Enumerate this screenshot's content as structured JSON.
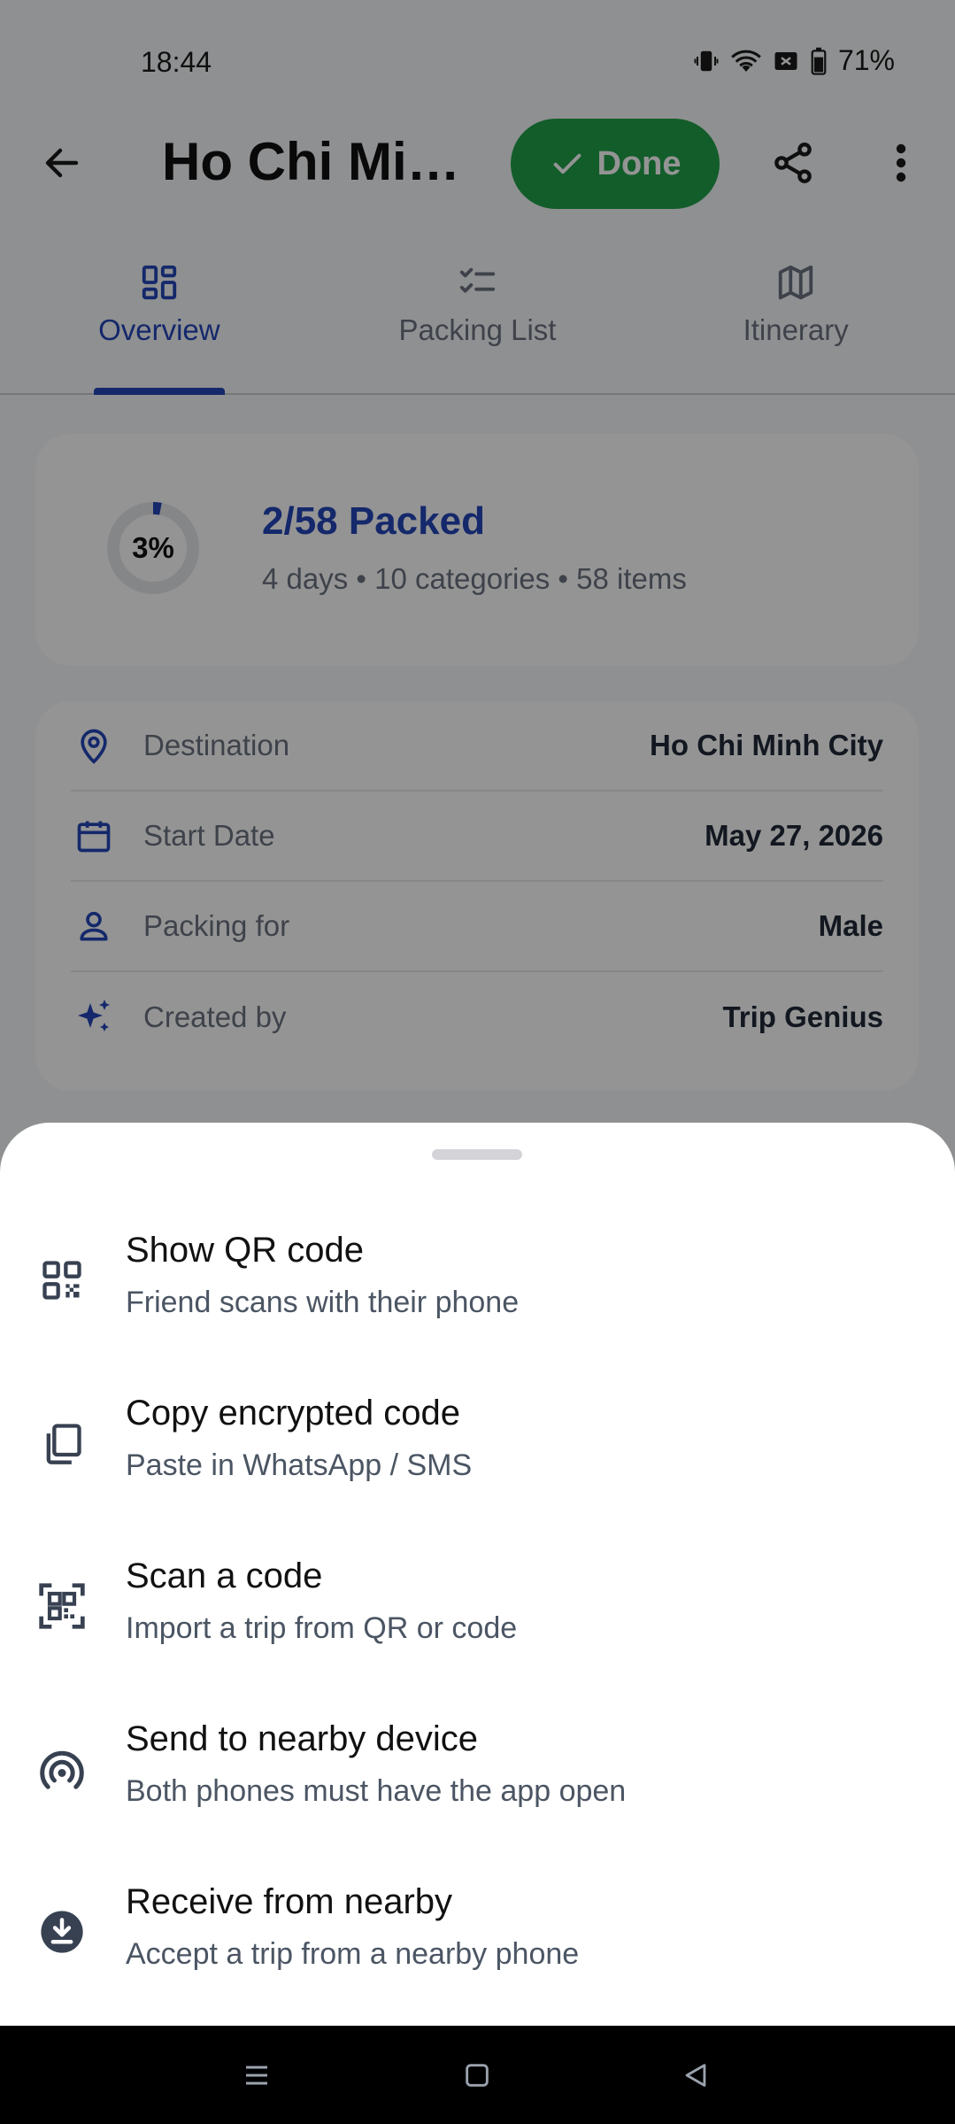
{
  "status_bar": {
    "time": "18:44",
    "battery": "71%"
  },
  "header": {
    "title": "Ho Chi Min…",
    "done_label": "Done"
  },
  "tabs": [
    {
      "label": "Overview",
      "icon": "dashboard-icon",
      "active": true
    },
    {
      "label": "Packing List",
      "icon": "checklist-icon",
      "active": false
    },
    {
      "label": "Itinerary",
      "icon": "map-icon",
      "active": false
    }
  ],
  "progress": {
    "percent_label": "3%",
    "fraction": 0.03,
    "title": "2/58 Packed",
    "subtitle": "4 days • 10 categories • 58 items"
  },
  "info": [
    {
      "icon": "location-pin-icon",
      "label": "Destination",
      "value": "Ho Chi Minh City"
    },
    {
      "icon": "calendar-icon",
      "label": "Start Date",
      "value": "May 27, 2026"
    },
    {
      "icon": "person-icon",
      "label": "Packing for",
      "value": "Male"
    },
    {
      "icon": "sparkle-icon",
      "label": "Created by",
      "value": "Trip Genius"
    }
  ],
  "sheet": {
    "items": [
      {
        "icon": "qr-code-icon",
        "title": "Show QR code",
        "subtitle": "Friend scans with their phone"
      },
      {
        "icon": "copy-icon",
        "title": "Copy encrypted code",
        "subtitle": "Paste in WhatsApp / SMS"
      },
      {
        "icon": "qr-scan-icon",
        "title": "Scan a code",
        "subtitle": "Import a trip from QR or code"
      },
      {
        "icon": "nearby-broadcast-icon",
        "title": "Send to nearby device",
        "subtitle": "Both phones must have the app open"
      },
      {
        "icon": "download-circle-icon",
        "title": "Receive from nearby",
        "subtitle": "Accept a trip from a nearby phone"
      }
    ]
  },
  "colors": {
    "primary": "#2346b8",
    "done_green": "#22a04b"
  }
}
